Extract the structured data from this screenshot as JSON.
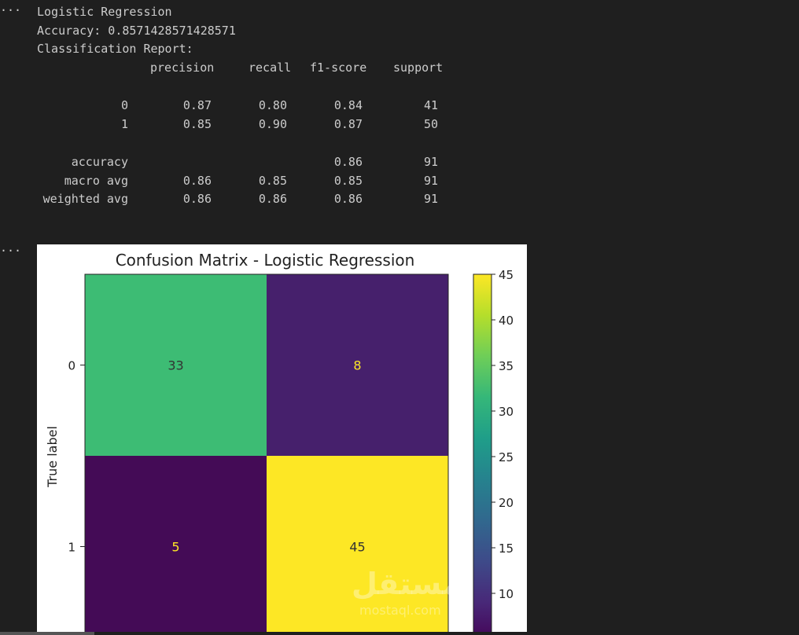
{
  "output_prefix": "···",
  "text_output": {
    "model_name": "Logistic Regression",
    "accuracy_line": "Accuracy: 0.8571428571428571",
    "report_heading": "Classification Report:",
    "report_columns": [
      "precision",
      "recall",
      "f1-score",
      "support"
    ],
    "report_rows": [
      {
        "label": "0",
        "precision": "0.87",
        "recall": "0.80",
        "f1": "0.84",
        "support": "41"
      },
      {
        "label": "1",
        "precision": "0.85",
        "recall": "0.90",
        "f1": "0.87",
        "support": "50"
      },
      {
        "label": "accuracy",
        "precision": "",
        "recall": "",
        "f1": "0.86",
        "support": "91"
      },
      {
        "label": "macro avg",
        "precision": "0.86",
        "recall": "0.85",
        "f1": "0.85",
        "support": "91"
      },
      {
        "label": "weighted avg",
        "precision": "0.86",
        "recall": "0.86",
        "f1": "0.86",
        "support": "91"
      }
    ]
  },
  "chart_data": {
    "type": "heatmap",
    "title": "Confusion Matrix - Logistic Regression",
    "ylabel": "True label",
    "row_labels": [
      "0",
      "1"
    ],
    "col_labels": [],
    "values": [
      [
        33,
        8
      ],
      [
        5,
        45
      ]
    ],
    "cell_colors": [
      [
        "#3dbc74",
        "#46206c"
      ],
      [
        "#440b56",
        "#fde725"
      ]
    ],
    "cell_text_colors": [
      [
        "#333333",
        "#fde725"
      ],
      [
        "#fde725",
        "#333333"
      ]
    ],
    "colorbar": {
      "ticks": [
        10,
        15,
        20,
        25,
        30,
        35,
        40,
        45
      ],
      "min": 5,
      "max": 45,
      "colormap": "viridis"
    }
  },
  "watermark": {
    "arabic": "مستقل",
    "latin": "mostaql.com"
  }
}
